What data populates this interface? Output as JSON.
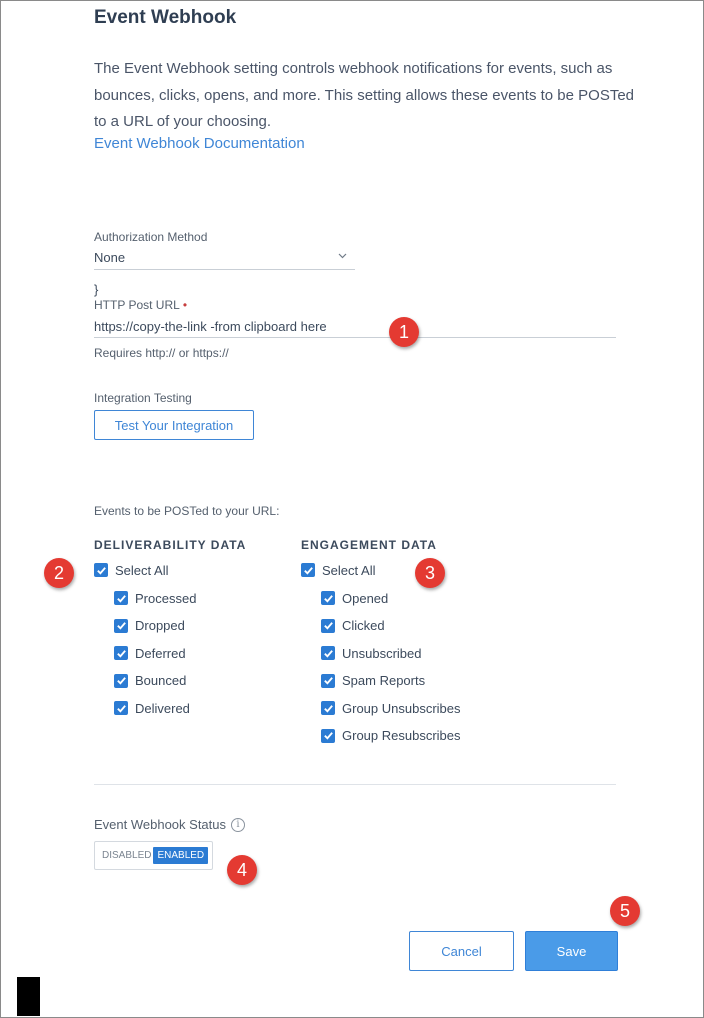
{
  "page": {
    "title": "Event Webhook",
    "description": "The Event Webhook setting controls webhook notifications for events, such as bounces, clicks, opens, and more. This setting allows these events to be POSTed to a URL of your choosing.",
    "doc_link": "Event Webhook Documentation"
  },
  "auth": {
    "label": "Authorization Method",
    "value": "None"
  },
  "stray_brace": "}",
  "http_post": {
    "label": "HTTP Post URL",
    "value": "https://copy-the-link -from clipboard here",
    "help": "Requires http:// or https://"
  },
  "integration": {
    "label": "Integration Testing",
    "button": "Test Your Integration"
  },
  "events": {
    "label": "Events to be POSTed to your URL:",
    "deliverability": {
      "heading": "DELIVERABILITY DATA",
      "select_all": "Select All",
      "items": [
        "Processed",
        "Dropped",
        "Deferred",
        "Bounced",
        "Delivered"
      ]
    },
    "engagement": {
      "heading": "ENGAGEMENT DATA",
      "select_all": "Select All",
      "items": [
        "Opened",
        "Clicked",
        "Unsubscribed",
        "Spam Reports",
        "Group Unsubscribes",
        "Group Resubscribes"
      ]
    }
  },
  "status": {
    "label": "Event Webhook Status",
    "info_icon": "i",
    "off": "DISABLED",
    "on": "ENABLED"
  },
  "actions": {
    "cancel": "Cancel",
    "save": "Save"
  },
  "markers": [
    "1",
    "2",
    "3",
    "4",
    "5"
  ],
  "colors": {
    "accent": "#3f86d6",
    "checkbox": "#2b7bd3",
    "save": "#4a9be8",
    "marker": "#e43a32"
  }
}
